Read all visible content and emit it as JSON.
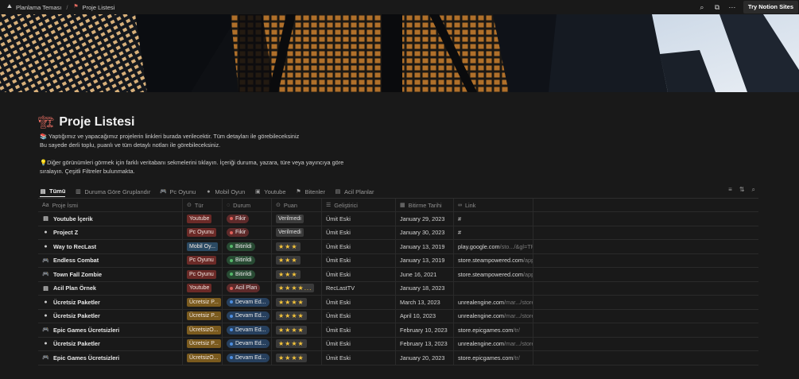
{
  "breadcrumb": {
    "workspace": "Planlama Teması",
    "separator": "/",
    "page": "Proje Listesi"
  },
  "topbar": {
    "try_label": "Try Notion Sites",
    "icons": [
      "search-icon",
      "duplicate-icon",
      "more-icon"
    ]
  },
  "page": {
    "title_emoji": "🏗",
    "title": "Proje Listesi",
    "desc_line1": "📚 Yaptığımız ve yapacağımız projelerin linkleri burada verilecektir. Tüm detayları ile görebileceksiniz",
    "desc_line2": "Bu sayede derli toplu, puanlı ve tüm detaylı notları ile görebileceksiniz.",
    "tip_line1": "💡Diğer görünümleri görmek için farklı veritabanı sekmelerini tıklayın. İçeriği duruma, yazara, türe veya yayıncıya göre",
    "tip_line2": "sıralayın. Çeşitli Filtreler bulunmakta."
  },
  "views": [
    {
      "label": "Tümü",
      "icon": "table-icon",
      "active": true
    },
    {
      "label": "Duruma Göre Gruplandır",
      "icon": "board-icon",
      "active": false
    },
    {
      "label": "Pc Oyunu",
      "icon": "gamepad-icon",
      "active": false
    },
    {
      "label": "Mobil Oyun",
      "icon": "circle-icon",
      "active": false
    },
    {
      "label": "Youtube",
      "icon": "video-icon",
      "active": false
    },
    {
      "label": "Bitenler",
      "icon": "flag-icon",
      "active": false
    },
    {
      "label": "Acil Planlar",
      "icon": "table-icon",
      "active": false
    }
  ],
  "columns": {
    "name": "Proje İsmi",
    "type": "Tür",
    "status": "Durum",
    "rating": "Puan",
    "developer": "Geliştirici",
    "end_date": "Bitirme Tarihi",
    "link": "Link"
  },
  "rows": [
    {
      "name": "Youtube İçerik",
      "icon": "table-icon",
      "type": "Youtube",
      "type_color": "#6b2a27",
      "status": "Fikir",
      "status_color": "#5e2a2a",
      "dot": "#e0605a",
      "rating": "Verilmedi",
      "stars": "",
      "developer": "Ümit Eski",
      "end_date": "January 29, 2023",
      "link": "#",
      "link_dim": ""
    },
    {
      "name": "Project Z",
      "icon": "circle-icon",
      "type": "Pc Oyunu",
      "type_color": "#6b2a27",
      "status": "Fikir",
      "status_color": "#5e2a2a",
      "dot": "#e0605a",
      "rating": "Verilmedi",
      "stars": "",
      "developer": "Ümit Eski",
      "end_date": "January 30, 2023",
      "link": "#",
      "link_dim": ""
    },
    {
      "name": "Way to RecLast",
      "icon": "circle-icon",
      "type": "Mobil Oy...",
      "type_color": "#2b4a63",
      "status": "Bitirildi",
      "status_color": "#284a33",
      "dot": "#55b86a",
      "rating": "",
      "stars": "★★★",
      "developer": "Ümit Eski",
      "end_date": "January 13, 2019",
      "link": "play.google.com",
      "link_dim": "/sto.../&gl=TR"
    },
    {
      "name": "Endless Combat",
      "icon": "gamepad-icon",
      "type": "Pc Oyunu",
      "type_color": "#6b2a27",
      "status": "Bitirildi",
      "status_color": "#284a33",
      "dot": "#55b86a",
      "rating": "",
      "stars": "★★★",
      "developer": "Ümit Eski",
      "end_date": "January 13, 2019",
      "link": "store.steampowered.com",
      "link_dim": "/app"
    },
    {
      "name": "Town Fall Zombie",
      "icon": "gamepad-icon",
      "type": "Pc Oyunu",
      "type_color": "#6b2a27",
      "status": "Bitirildi",
      "status_color": "#284a33",
      "dot": "#55b86a",
      "rating": "",
      "stars": "★★★",
      "developer": "Ümit Eski",
      "end_date": "June 16, 2021",
      "link": "store.steampowered.com",
      "link_dim": "/app"
    },
    {
      "name": "Acil Plan Örnek",
      "icon": "table-icon",
      "type": "Youtube",
      "type_color": "#6b2a27",
      "status": "Acil Plan",
      "status_color": "#5e2a2a",
      "dot": "#e0605a",
      "rating": "",
      "stars": "★★★★...",
      "developer": "RecLastTV",
      "end_date": "January 18, 2023",
      "link": "",
      "link_dim": ""
    },
    {
      "name": "Ücretsiz Paketler",
      "icon": "circle-icon",
      "type": "Ücretsiz P...",
      "type_color": "#7a5a1e",
      "status": "Devam Ed...",
      "status_color": "#27405e",
      "dot": "#4e8ee0",
      "rating": "",
      "stars": "★★★★",
      "developer": "Ümit Eski",
      "end_date": "March 13, 2023",
      "link": "unrealengine.com",
      "link_dim": "/mar.../store"
    },
    {
      "name": "Ücretsiz Paketler",
      "icon": "circle-icon",
      "type": "Ücretsiz P...",
      "type_color": "#7a5a1e",
      "status": "Devam Ed...",
      "status_color": "#27405e",
      "dot": "#4e8ee0",
      "rating": "",
      "stars": "★★★★",
      "developer": "Ümit Eski",
      "end_date": "April 10, 2023",
      "link": "unrealengine.com",
      "link_dim": "/mar.../store"
    },
    {
      "name": "Epic Games Ücretsizleri",
      "icon": "gamepad-icon",
      "type": "ÜcretsizO...",
      "type_color": "#7a5a1e",
      "status": "Devam Ed...",
      "status_color": "#27405e",
      "dot": "#4e8ee0",
      "rating": "",
      "stars": "★★★★",
      "developer": "Ümit Eski",
      "end_date": "February 10, 2023",
      "link": "store.epicgames.com",
      "link_dim": "/tr/"
    },
    {
      "name": "Ücretsiz Paketler",
      "icon": "circle-icon",
      "type": "Ücretsiz P...",
      "type_color": "#7a5a1e",
      "status": "Devam Ed...",
      "status_color": "#27405e",
      "dot": "#4e8ee0",
      "rating": "",
      "stars": "★★★★",
      "developer": "Ümit Eski",
      "end_date": "February 13, 2023",
      "link": "unrealengine.com",
      "link_dim": "/mar.../store"
    },
    {
      "name": "Epic Games Ücretsizleri",
      "icon": "gamepad-icon",
      "type": "ÜcretsizO...",
      "type_color": "#7a5a1e",
      "status": "Devam Ed...",
      "status_color": "#27405e",
      "dot": "#4e8ee0",
      "rating": "",
      "stars": "★★★★",
      "developer": "Ümit Eski",
      "end_date": "January 20, 2023",
      "link": "store.epicgames.com",
      "link_dim": "/tr/"
    }
  ]
}
